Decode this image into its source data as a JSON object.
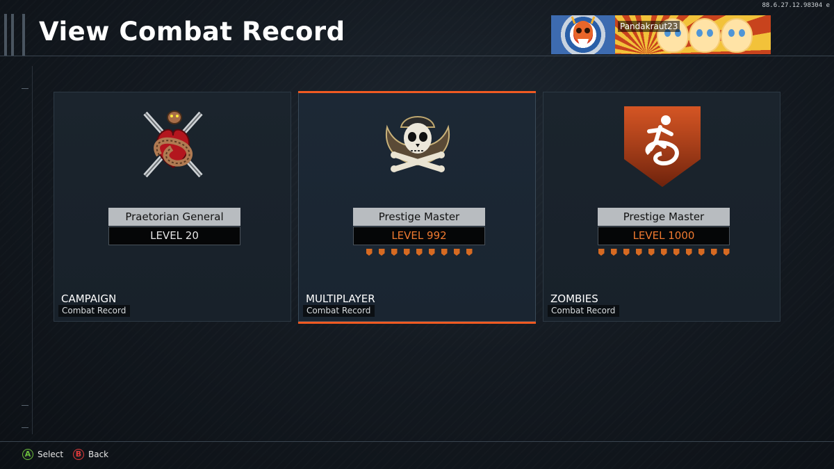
{
  "build_id": "88.6.27.12.98304 e",
  "header": {
    "title": "View Combat Record",
    "gamertag": "Pandakraut23",
    "emblem_icon": "skull-emblem-icon",
    "calling_card_icon": "chick-calling-card-icon"
  },
  "accent_color": "#f05a22",
  "cards": [
    {
      "mode": "CAMPAIGN",
      "subtitle": "Combat Record",
      "rank_title": "Praetorian General",
      "level": "LEVEL 20",
      "icon": "snake-heart-icon",
      "selected": false,
      "prestige_pips": 0
    },
    {
      "mode": "MULTIPLAYER",
      "subtitle": "Combat Record",
      "rank_title": "Prestige Master",
      "level": "LEVEL 992",
      "icon": "skull-crossbones-icon",
      "selected": true,
      "prestige_pips": 9
    },
    {
      "mode": "ZOMBIES",
      "subtitle": "Combat Record",
      "rank_title": "Prestige Master",
      "level": "LEVEL 1000",
      "icon": "runner-shield-icon",
      "selected": false,
      "prestige_pips": 11
    }
  ],
  "footer": {
    "select_glyph": "A",
    "select_label": "Select",
    "back_glyph": "B",
    "back_label": "Back"
  }
}
